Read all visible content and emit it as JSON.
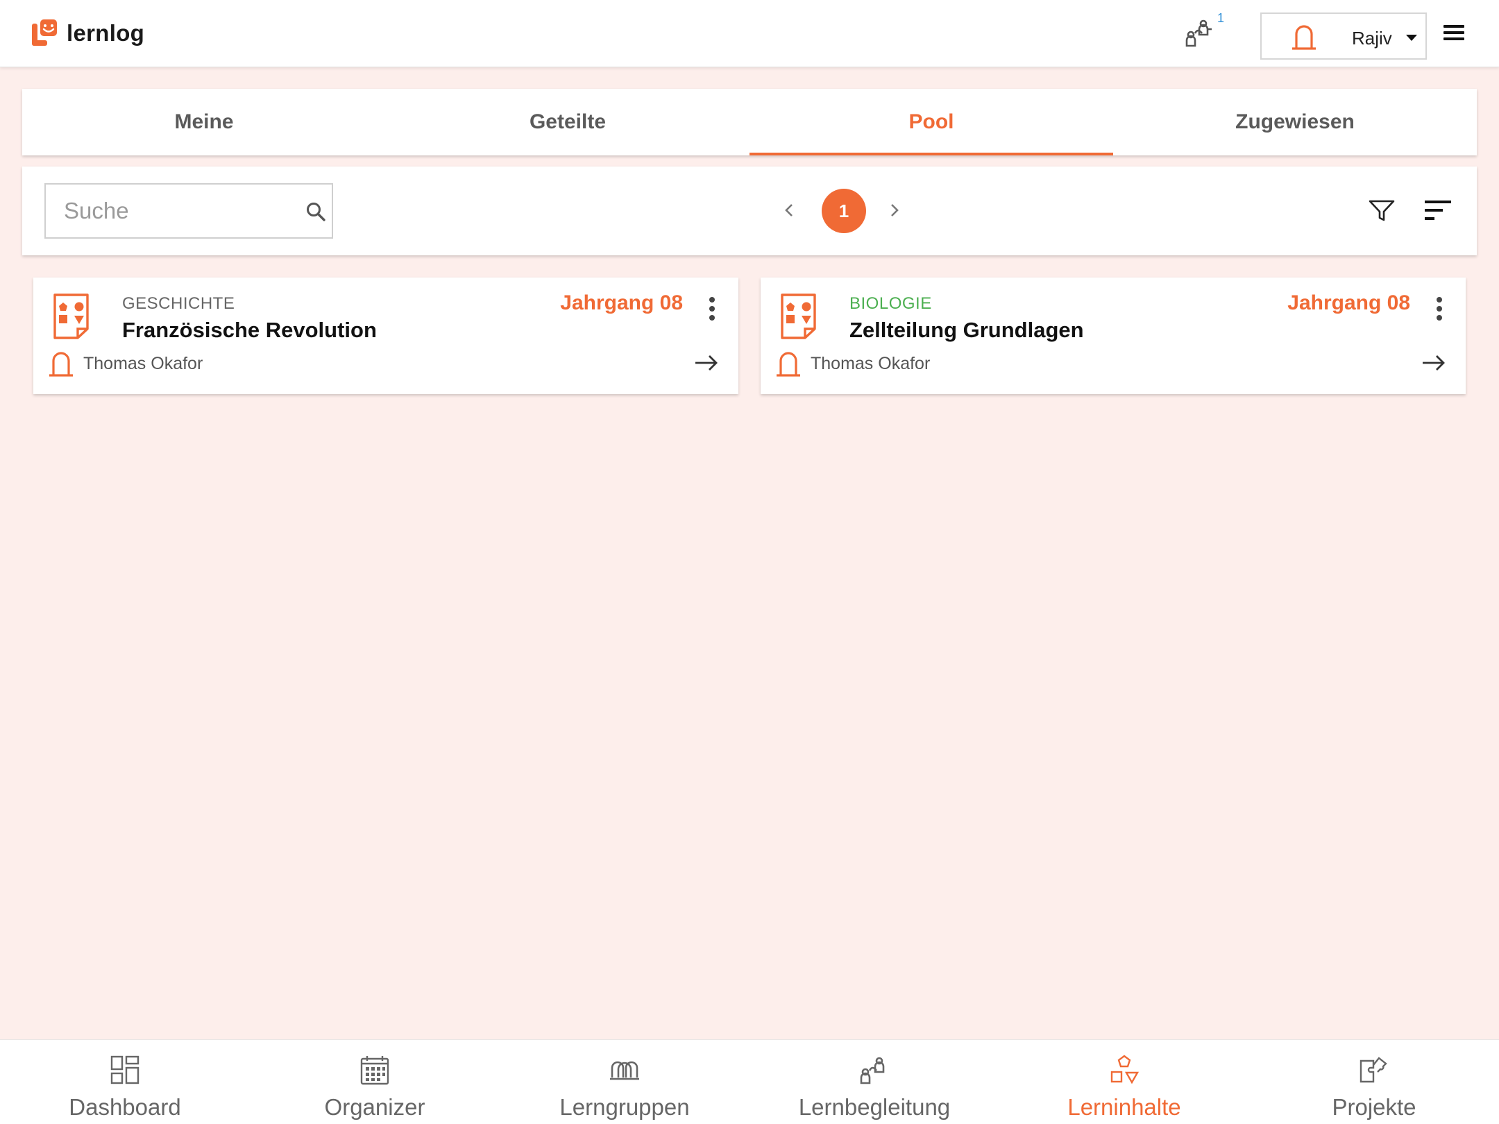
{
  "app": {
    "name": "lernlog"
  },
  "header": {
    "notification_count": "1",
    "user_name": "Rajiv"
  },
  "tabs": [
    {
      "label": "Meine",
      "active": false
    },
    {
      "label": "Geteilte",
      "active": false
    },
    {
      "label": "Pool",
      "active": true
    },
    {
      "label": "Zugewiesen",
      "active": false
    }
  ],
  "toolbar": {
    "search_placeholder": "Suche",
    "current_page": "1"
  },
  "cards": [
    {
      "subject": "GESCHICHTE",
      "subject_color": "#666666",
      "title": "Französische Revolution",
      "grade": "Jahrgang 08",
      "author": "Thomas Okafor"
    },
    {
      "subject": "BIOLOGIE",
      "subject_color": "#4caf50",
      "title": "Zellteilung Grundlagen",
      "grade": "Jahrgang 08",
      "author": "Thomas Okafor"
    }
  ],
  "bottom_nav": [
    {
      "label": "Dashboard",
      "icon": "dashboard-icon",
      "active": false
    },
    {
      "label": "Organizer",
      "icon": "calendar-icon",
      "active": false
    },
    {
      "label": "Lerngruppen",
      "icon": "group-icon",
      "active": false
    },
    {
      "label": "Lernbegleitung",
      "icon": "mentoring-icon",
      "active": false
    },
    {
      "label": "Lerninhalte",
      "icon": "shapes-icon",
      "active": true
    },
    {
      "label": "Projekte",
      "icon": "projects-icon",
      "active": false
    }
  ],
  "colors": {
    "accent": "#f06a35",
    "background": "#fdeeeb",
    "biology": "#4caf50"
  }
}
